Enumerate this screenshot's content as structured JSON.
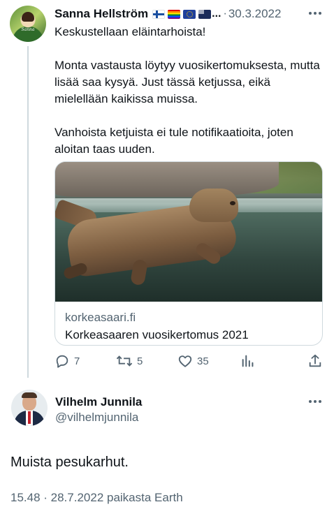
{
  "tweet1": {
    "author_name": "Sanna Hellström",
    "author_name_truncation": "...",
    "separator": "·",
    "date": "30.3.2022",
    "avatar_text": "Sanna",
    "flags": [
      "finland-flag",
      "rainbow-flag",
      "eu-flag",
      "dark-flag"
    ],
    "paragraphs": [
      "Keskustellaan eläintarhoista!",
      "Monta vastausta löytyy vuosikertomuksesta, mutta lisää saa kysyä. Just tässä ketjussa, eikä mielellään kaikissa muissa.",
      "Vanhoista ketjuista ei tule notifikaatioita, joten aloitan taas uuden."
    ],
    "card": {
      "domain": "korkeasaari.fi",
      "title": "Korkeasaaren vuosikertomus 2021"
    },
    "actions": {
      "replies": "7",
      "retweets": "5",
      "likes": "35"
    }
  },
  "tweet2": {
    "author_name": "Vilhelm Junnila",
    "handle": "@vilhelmjunnila",
    "text": "Muista pesukarhut.",
    "meta": "15.48 · 28.7.2022 paikasta Earth"
  },
  "colors": {
    "text_primary": "#0f1419",
    "text_secondary": "#536471",
    "border": "#cfd9de"
  }
}
